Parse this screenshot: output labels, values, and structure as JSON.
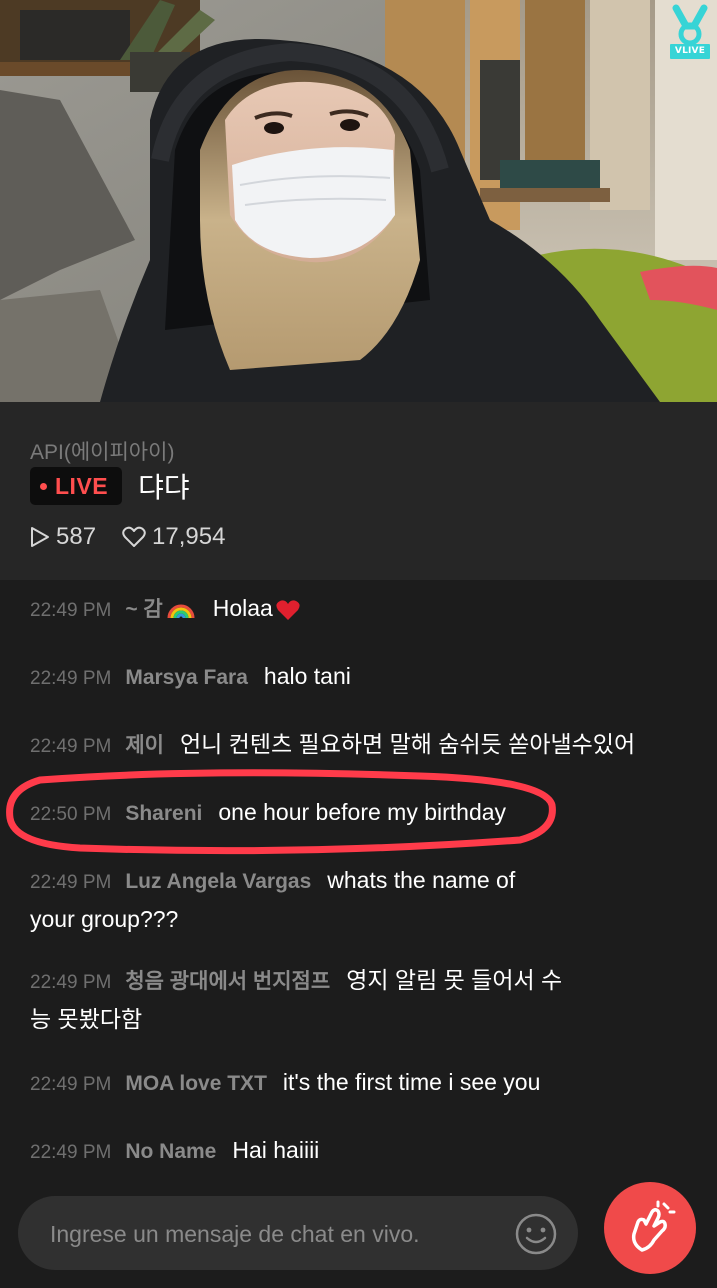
{
  "brand": {
    "logo_text": "VLIVE"
  },
  "stream": {
    "channel": "API(에이피아이)",
    "live_label": "LIVE",
    "title": "댜댜",
    "plays": "587",
    "likes": "17,954"
  },
  "chat": {
    "messages": [
      {
        "time": "22:49 PM",
        "user": "~ 감",
        "text": "Holaa",
        "emoji": "rainbow",
        "trail": "heart"
      },
      {
        "time": "22:49 PM",
        "user": "Marsya Fara",
        "text": "halo tani"
      },
      {
        "time": "22:49 PM",
        "user": "제이",
        "text": "언니 컨텐츠 필요하면 말해 숨쉬듯 쏟아낼수있어"
      },
      {
        "time": "22:50 PM",
        "user": "Shareni",
        "text": "one hour before my birthday",
        "highlighted": true
      },
      {
        "time": "22:49 PM",
        "user": "Luz Angela Vargas",
        "text": "whats the name of your group???"
      },
      {
        "time": "22:49 PM",
        "user": "청음 광대에서 번지점프",
        "text": "영지 알림 못 들어서 수능 못봤다함"
      },
      {
        "time": "22:49 PM",
        "user": "MOA love TXT",
        "text": "it's the first time i see you"
      },
      {
        "time": "22:49 PM",
        "user": "No Name",
        "text": "Hai haiiii"
      }
    ]
  },
  "input": {
    "placeholder": "Ingrese un mensaje de chat en vivo."
  },
  "colors": {
    "live_red": "#ff4e4e",
    "heart_button": "#f04a4a",
    "vlive_cyan": "#37d4d6",
    "annotation_red": "#ff3b4a"
  }
}
